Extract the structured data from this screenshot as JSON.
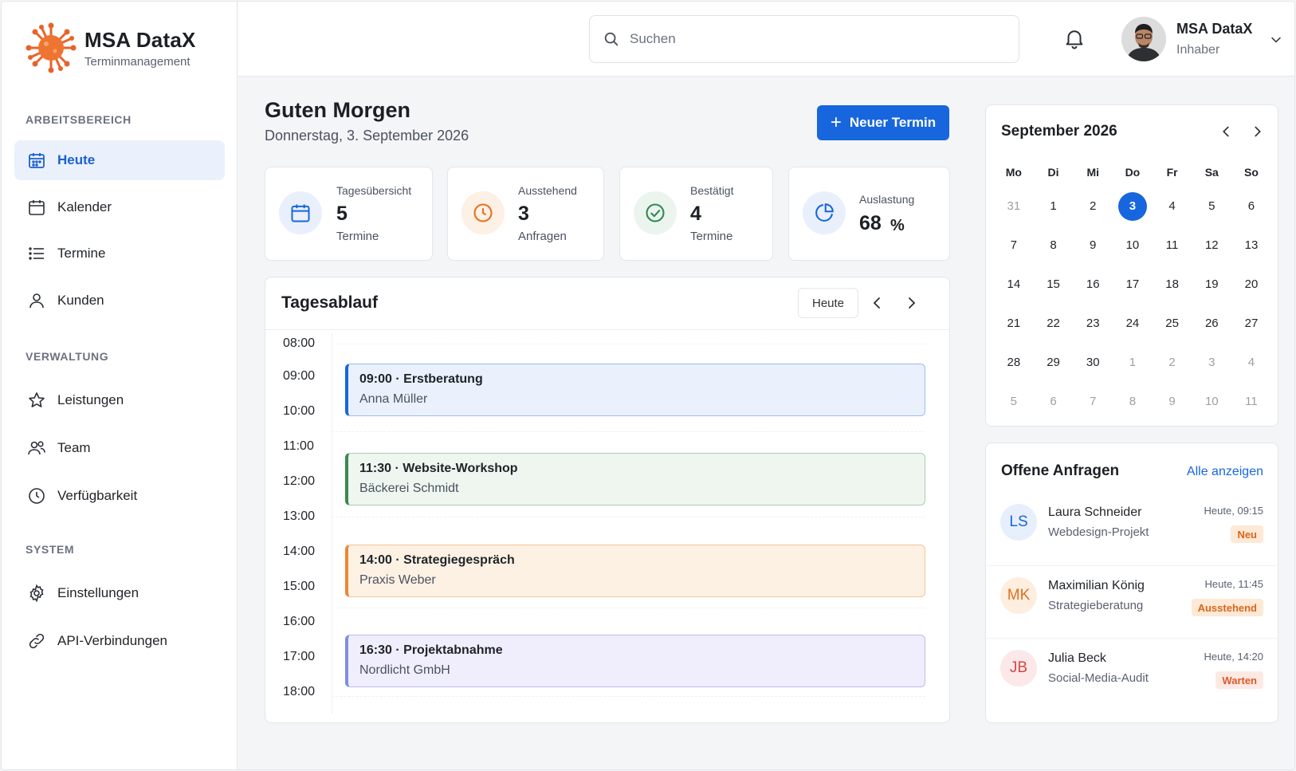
{
  "brand": {
    "name": "MSA DataX",
    "subtitle": "Terminmanagement"
  },
  "sidebar": {
    "sections": [
      {
        "title": "ARBEITSBEREICH"
      },
      {
        "title": "VERWALTUNG"
      },
      {
        "title": "SYSTEM"
      }
    ],
    "items": [
      {
        "label": "Heute",
        "icon": "calendar-icon",
        "active": true
      },
      {
        "label": "Kalender",
        "icon": "calendar-icon"
      },
      {
        "label": "Termine",
        "icon": "list-icon"
      },
      {
        "label": "Kunden",
        "icon": "user-icon"
      },
      {
        "label": "Leistungen",
        "icon": "star-icon"
      },
      {
        "label": "Team",
        "icon": "team-icon"
      },
      {
        "label": "Verfügbarkeit",
        "icon": "clock-icon"
      },
      {
        "label": "Einstellungen",
        "icon": "gear-icon"
      },
      {
        "label": "API-Verbindungen",
        "icon": "link-icon"
      }
    ]
  },
  "header": {
    "search": {
      "placeholder": "Suchen",
      "value": ""
    },
    "user": {
      "name": "MSA DataX",
      "role": "Inhaber"
    }
  },
  "main": {
    "greeting": "Guten Morgen",
    "date": "Donnerstag, 3. September 2026",
    "new_button": "Neuer Termin",
    "stats": [
      {
        "label": "Tagesübersicht",
        "value": "5",
        "unit": "Termine",
        "color": "#1766dd"
      },
      {
        "label": "Ausstehend",
        "value": "3",
        "unit": "Anfragen",
        "color": "#e8711f"
      },
      {
        "label": "Bestätigt",
        "value": "4",
        "unit": "Termine",
        "color": "#2f8a4e"
      },
      {
        "label": "Auslastung",
        "value": "68",
        "unit": "%",
        "color": "#1766dd"
      }
    ]
  },
  "schedule": {
    "title": "Tagesablauf",
    "today_button": "Heute",
    "hours": [
      "08:00",
      "09:00",
      "10:00",
      "11:00",
      "12:00",
      "13:00",
      "14:00",
      "15:00",
      "16:00",
      "17:00",
      "18:00"
    ],
    "events": [
      {
        "title": "09:00 · Erstberatung",
        "sub": "Anna Müller",
        "accent": "#1766dd",
        "bg": "#eaf1fc",
        "border": "#9bbcf0"
      },
      {
        "title": "11:30 · Website-Workshop",
        "sub": "Bäckerei Schmidt",
        "accent": "#3a8a4e",
        "bg": "#eef6ef",
        "border": "#aacdb4"
      },
      {
        "title": "14:00 · Strategiegespräch",
        "sub": "Praxis Weber",
        "accent": "#ee8633",
        "bg": "#fdf1e4",
        "border": "#f3c597"
      },
      {
        "title": "16:30 · Projektabnahme",
        "sub": "Nordlicht GmbH",
        "accent": "#7f8ee3",
        "bg": "#f0eefc",
        "border": "#bdbbe8"
      }
    ]
  },
  "calendar": {
    "title": "September 2026",
    "weekdays": [
      "Mo",
      "Di",
      "Mi",
      "Do",
      "Fr",
      "Sa",
      "So"
    ],
    "weeks": [
      [
        "31",
        "1",
        "2",
        "3",
        "4",
        "5",
        "6"
      ],
      [
        "7",
        "8",
        "9",
        "10",
        "11",
        "12",
        "13"
      ],
      [
        "14",
        "15",
        "16",
        "17",
        "18",
        "19",
        "20"
      ],
      [
        "21",
        "22",
        "23",
        "24",
        "25",
        "26",
        "27"
      ],
      [
        "28",
        "29",
        "30",
        "1",
        "2",
        "3",
        "4"
      ],
      [
        "5",
        "6",
        "7",
        "8",
        "9",
        "10",
        "11"
      ]
    ],
    "selected": "3"
  },
  "requests": {
    "title": "Offene Anfragen",
    "all_link": "Alle anzeigen",
    "items": [
      {
        "initials": "LS",
        "name": "Laura Schneider",
        "sub": "Webdesign-Projekt",
        "time": "Heute, 09:15",
        "badge": "Neu",
        "avatar_bg": "#e7effc",
        "avatar_fg": "#1766dd",
        "badge_bg": "#fde9d6",
        "badge_fg": "#d9661a"
      },
      {
        "initials": "MK",
        "name": "Maximilian König",
        "sub": "Strategieberatung",
        "time": "Heute, 11:45",
        "badge": "Ausstehend",
        "avatar_bg": "#fdeee0",
        "avatar_fg": "#e0701e",
        "badge_bg": "#fde9d6",
        "badge_fg": "#d9661a"
      },
      {
        "initials": "JB",
        "name": "Julia Beck",
        "sub": "Social-Media-Audit",
        "time": "Heute, 14:20",
        "badge": "Warten",
        "avatar_bg": "#fce8e8",
        "avatar_fg": "#d64545",
        "badge_bg": "#fde9e3",
        "badge_fg": "#d95a2b"
      }
    ]
  }
}
